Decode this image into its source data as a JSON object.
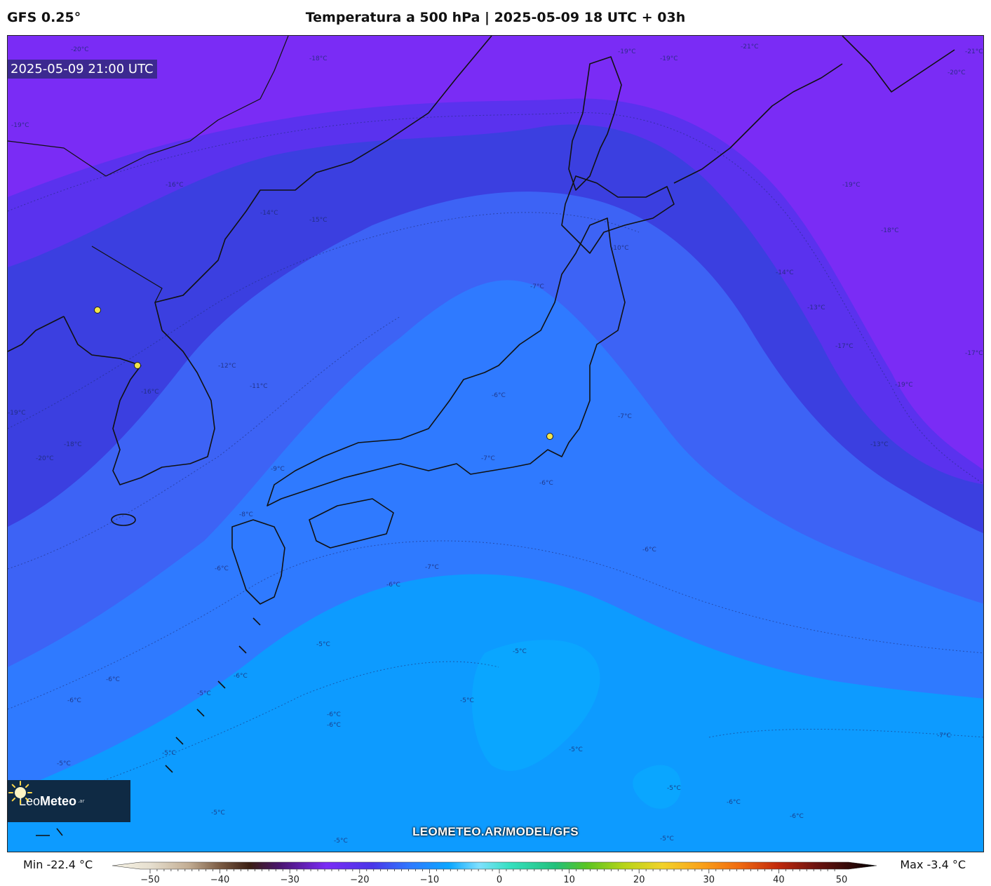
{
  "header": {
    "model": "GFS 0.25°",
    "title": "Temperatura a 500 hPa | 2025-05-09 18 UTC + 03h"
  },
  "map": {
    "valid_time": "2025-05-09 21:00 UTC",
    "website": "LEOMETEO.AR/MODEL/GFS",
    "logo": {
      "brand_light": "Leo",
      "brand_bold": "Meteo",
      "tld": ".ar"
    },
    "contour_labels": [
      "-20°C",
      "-18°C",
      "-19°C",
      "-19°C",
      "-21°C",
      "-21°C",
      "-20°C",
      "-19°C",
      "-16°C",
      "-14°C",
      "-15°C",
      "-10°C",
      "-7°C",
      "-19°C",
      "-18°C",
      "-14°C",
      "-13°C",
      "-17°C",
      "-17°C",
      "-19°C",
      "-12°C",
      "-11°C",
      "-16°C",
      "-19°C",
      "-18°C",
      "-20°C",
      "-9°C",
      "-6°C",
      "-7°C",
      "-7°C",
      "-6°C",
      "-13°C",
      "-8°C",
      "-6°C",
      "-6°C",
      "-7°C",
      "-6°C",
      "-5°C",
      "-6°C",
      "-6°C",
      "-6°C",
      "-5°C",
      "-5°C",
      "-6°C",
      "-5°C",
      "-6°C",
      "-5°C",
      "-5°C",
      "-5°C",
      "-5°C",
      "-6°C",
      "-5°C",
      "-6°C",
      "-5°C",
      "-7°C",
      "-5°C"
    ],
    "cities": [
      "dot",
      "dot",
      "dot"
    ]
  },
  "colors": {
    "purple": "#7a2cf5",
    "violet": "#5a32ee",
    "deep_blue": "#3b3fe0",
    "blue": "#3d63f5",
    "mid_blue": "#2f7aff",
    "light_blue": "#0d9bff",
    "cyan_blue": "#0aa6ff"
  },
  "legend": {
    "min": "Min -22.4 °C",
    "max": "Max -3.4 °C",
    "ticks": [
      "−50",
      "−40",
      "−30",
      "−20",
      "−10",
      "0",
      "10",
      "20",
      "30",
      "40",
      "50"
    ]
  }
}
